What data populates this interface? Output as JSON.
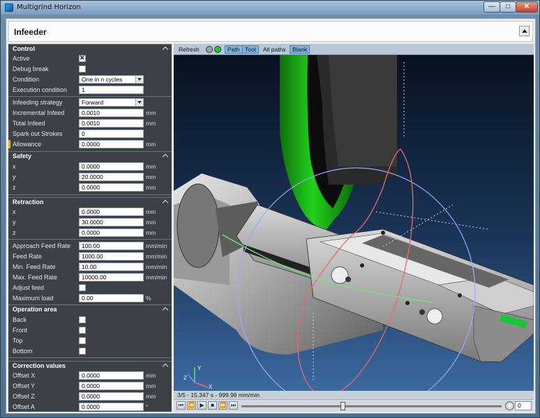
{
  "window": {
    "title": "Multigrind Horizon",
    "min_glyph": "—",
    "max_glyph": "□",
    "close_glyph": "✕"
  },
  "header": {
    "title": "Infeeder"
  },
  "control": {
    "title": "Control",
    "active_label": "Active",
    "active_checked": true,
    "debug_label": "Debug break",
    "debug_checked": false,
    "condition_label": "Condition",
    "condition_value": "One in n cycles",
    "exec_label": "Execution condition",
    "exec_value": "1",
    "strategy_label": "Infeeding strategy",
    "strategy_value": "Forward",
    "inc_label": "Incremental Infeed",
    "inc_value": "0.0010",
    "total_label": "Total Infeed",
    "total_value": "0.0010",
    "spark_label": "Spark out Strokes",
    "spark_value": "0",
    "allow_label": "Allowance",
    "allow_value": "0.0000",
    "unit_mm": "mm"
  },
  "safety": {
    "title": "Safety",
    "x_label": "x",
    "x_value": "0.0000",
    "y_label": "y",
    "y_value": "20.0000",
    "z_label": "z",
    "z_value": "0.0000"
  },
  "retraction": {
    "title": "Retraction",
    "x_label": "x",
    "x_value": "0.0000",
    "y_label": "y",
    "y_value": "30.0000",
    "z_label": "z",
    "z_value": "0.0000",
    "approach_label": "Approach Feed Rate",
    "approach_value": "100.00",
    "feed_label": "Feed Rate",
    "feed_value": "1000.00",
    "minfeed_label": "Min. Feed Rate",
    "minfeed_value": "10.00",
    "maxfeed_label": "Max. Feed Rate",
    "maxfeed_value": "10000.00",
    "adjust_label": "Adjust feed",
    "adjust_checked": false,
    "maxload_label": "Maximum load",
    "maxload_value": "0.00",
    "unit_mmmin": "mm/min",
    "unit_pct": "%"
  },
  "operation": {
    "title": "Operation area",
    "back_label": "Back",
    "back_checked": false,
    "front_label": "Front",
    "front_checked": false,
    "top_label": "Top",
    "top_checked": false,
    "bottom_label": "Bottom",
    "bottom_checked": false
  },
  "correction": {
    "title": "Correction values",
    "ox_label": "Offset X",
    "ox_value": "0.0000",
    "oy_label": "Offset Y",
    "oy_value": "0.0000",
    "oz_label": "Offset Z",
    "oz_value": "0.0000",
    "oa_label": "Offset A",
    "oa_value": "0.0000",
    "unit_deg": "°"
  },
  "viewer": {
    "refresh_label": "Refresh",
    "path_label": "Path",
    "tool_label": "Tool",
    "allpaths_label": "All paths",
    "blank_label": "Blank",
    "status_text": "3/5 - 15.347 s - 999.99 mm/min",
    "spin_value": "0",
    "slider_position": 0.39,
    "axis_x": "X",
    "axis_y": "Y",
    "axis_z": "Z",
    "colors": {
      "wheel": "#22d11b",
      "path": "#e86a6a",
      "orbit": "#9da8ff",
      "green_path": "#71e67a"
    }
  }
}
